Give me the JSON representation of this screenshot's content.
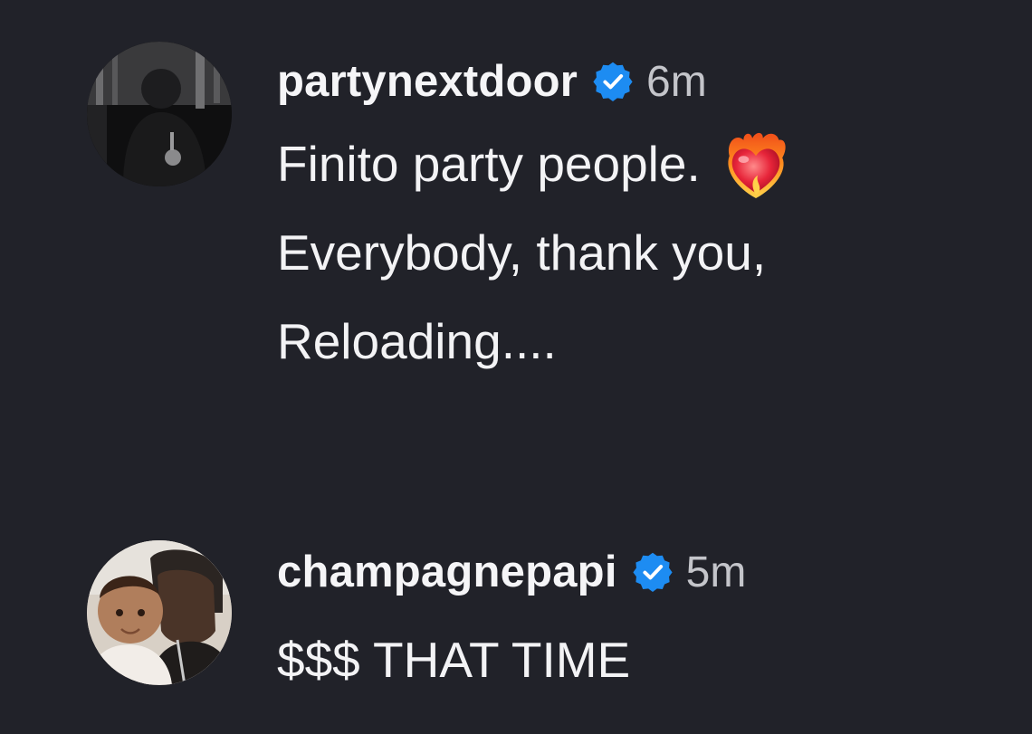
{
  "comments": [
    {
      "username": "partynextdoor",
      "verified": true,
      "timestamp": "6m",
      "lines": [
        "Finito party people.",
        "Everybody, thank you,",
        "Reloading...."
      ],
      "emoji": "heart-on-fire-icon"
    },
    {
      "username": "champagnepapi",
      "verified": true,
      "timestamp": "5m",
      "lines": [
        "$$$ THAT TIME"
      ]
    }
  ],
  "colors": {
    "background": "#212229",
    "text": "#f3f3f5",
    "timestamp": "#c4c5ca",
    "verified_badge": "#1d8cf2"
  }
}
